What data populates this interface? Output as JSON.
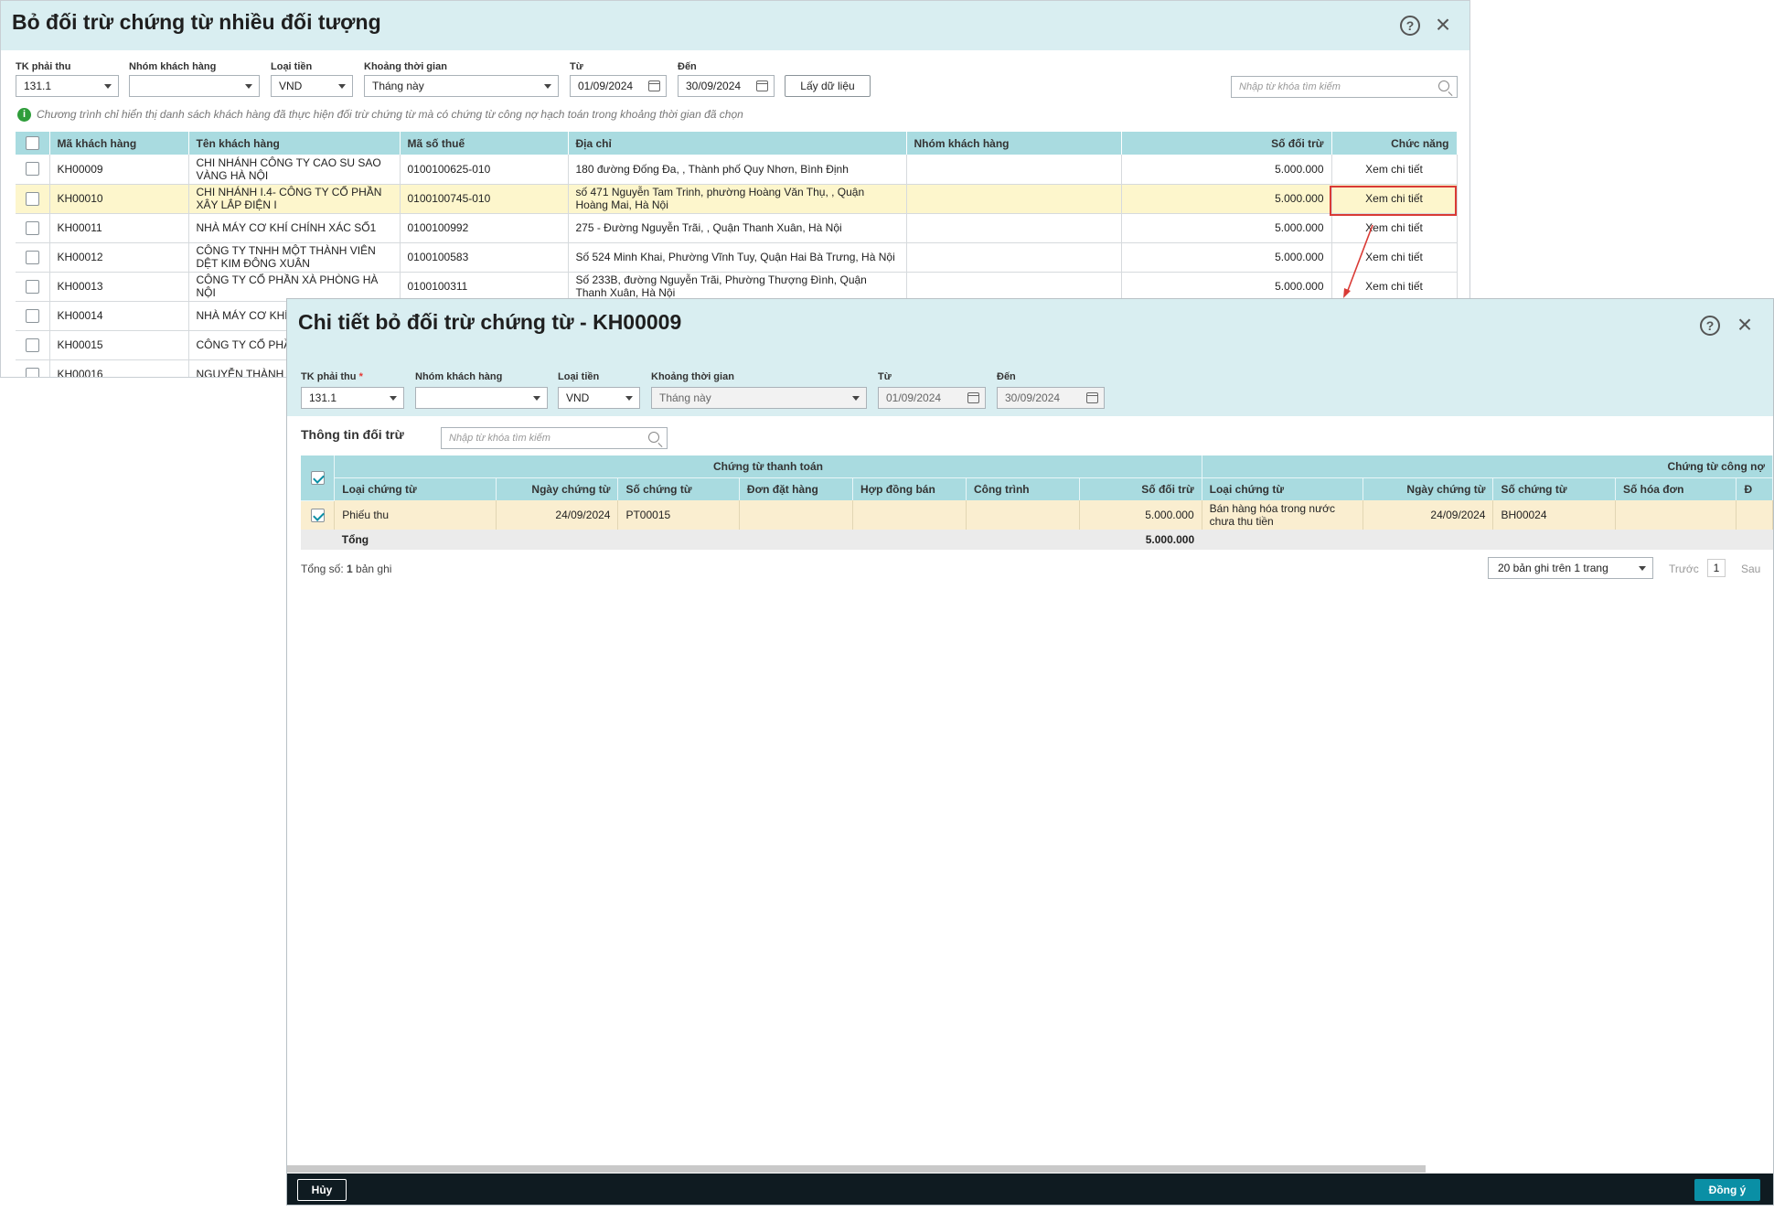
{
  "win1": {
    "title": "Bỏ đối trừ chứng từ nhiều đối tượng",
    "filters": {
      "account_label": "TK phải thu",
      "account_value": "131.1",
      "group_label": "Nhóm khách hàng",
      "group_value": "",
      "currency_label": "Loại tiền",
      "currency_value": "VND",
      "period_label": "Khoảng thời gian",
      "period_value": "Tháng này",
      "from_label": "Từ",
      "from_value": "01/09/2024",
      "to_label": "Đến",
      "to_value": "30/09/2024",
      "fetch_button": "Lấy dữ liệu",
      "search_placeholder": "Nhập từ khóa tìm kiếm"
    },
    "info": "Chương trình chỉ hiển thị danh sách khách hàng đã thực hiện đối trừ chứng từ mà có chứng từ công nợ hạch toán trong khoảng thời gian đã chọn",
    "columns": [
      "Mã khách hàng",
      "Tên khách hàng",
      "Mã số thuế",
      "Địa chỉ",
      "Nhóm khách hàng",
      "Số đối trừ",
      "Chức năng"
    ],
    "rows": [
      {
        "code": "KH00009",
        "name": "CHI NHÁNH CÔNG TY CAO SU SAO VÀNG HÀ NỘI",
        "tax": "0100100625-010",
        "address": "180 đường Đống Đa, , Thành phố Quy Nhơn, Bình Định",
        "group": "",
        "amount": "5.000.000",
        "action": "Xem chi tiết"
      },
      {
        "code": "KH00010",
        "name": "CHI NHÁNH I.4- CÔNG TY CỔ PHẦN XÂY LẮP ĐIỆN I",
        "tax": "0100100745-010",
        "address": "số 471 Nguyễn Tam Trinh, phường Hoàng Văn Thụ, , Quận Hoàng Mai, Hà Nội",
        "group": "",
        "amount": "5.000.000",
        "action": "Xem chi tiết"
      },
      {
        "code": "KH00011",
        "name": "NHÀ MÁY CƠ KHÍ CHÍNH XÁC SỐ1",
        "tax": "0100100992",
        "address": "275 - Đường Nguyễn Trãi, , Quận Thanh Xuân, Hà Nội",
        "group": "",
        "amount": "5.000.000",
        "action": "Xem chi tiết"
      },
      {
        "code": "KH00012",
        "name": "CÔNG TY TNHH MỘT THÀNH VIÊN DỆT KIM ĐÔNG XUÂN",
        "tax": "0100100583",
        "address": "Số 524 Minh Khai, Phường Vĩnh Tuy, Quận Hai Bà Trưng, Hà Nội",
        "group": "",
        "amount": "5.000.000",
        "action": "Xem chi tiết"
      },
      {
        "code": "KH00013",
        "name": "CÔNG TY CỔ PHẦN XÀ PHÒNG HÀ NỘI",
        "tax": "0100100311",
        "address": "Số 233B, đường Nguyễn Trãi, Phường Thượng Đình, Quận Thanh Xuân, Hà Nội",
        "group": "",
        "amount": "5.000.000",
        "action": "Xem chi tiết"
      },
      {
        "code": "KH00014",
        "name": "NHÀ MÁY CƠ KHÍ",
        "tax": "",
        "address": "",
        "group": "",
        "amount": "",
        "action": ""
      },
      {
        "code": "KH00015",
        "name": "CÔNG TY CỔ PHẦ",
        "tax": "",
        "address": "",
        "group": "",
        "amount": "",
        "action": ""
      },
      {
        "code": "KH00016",
        "name": "NGUYỄN THÀNH T",
        "tax": "",
        "address": "",
        "group": "",
        "amount": "",
        "action": ""
      }
    ]
  },
  "win2": {
    "title": "Chi tiết bỏ đối trừ chứng từ - KH00009",
    "filters": {
      "account_label": "TK phải thu",
      "account_required": "*",
      "account_value": "131.1",
      "group_label": "Nhóm khách hàng",
      "group_value": "",
      "currency_label": "Loại tiền",
      "currency_value": "VND",
      "period_label": "Khoảng thời gian",
      "period_value": "Tháng này",
      "from_label": "Từ",
      "from_value": "01/09/2024",
      "to_label": "Đến",
      "to_value": "30/09/2024"
    },
    "section_title": "Thông tin đối trừ",
    "search_placeholder": "Nhập từ khóa tìm kiếm",
    "group_payment": "Chứng từ thanh toán",
    "group_debt": "Chứng từ công nợ",
    "payment_columns": [
      "Loại chứng từ",
      "Ngày chứng từ",
      "Số chứng từ",
      "Đơn đặt hàng",
      "Hợp đồng bán",
      "Công trình",
      "Số đối trừ"
    ],
    "debt_columns": [
      "Loại chứng từ",
      "Ngày chứng từ",
      "Số chứng từ",
      "Số hóa đơn",
      "Đ"
    ],
    "row": {
      "pay_type": "Phiếu thu",
      "pay_date": "24/09/2024",
      "pay_no": "PT00015",
      "order": "",
      "contract": "",
      "project": "",
      "amount": "5.000.000",
      "debt_type": "Bán hàng hóa trong nước chưa thu tiền",
      "debt_date": "24/09/2024",
      "debt_no": "BH00024",
      "invoice_no": ""
    },
    "total_label": "Tổng",
    "total_amount": "5.000.000",
    "record_prefix": "Tổng số: ",
    "record_count": "1",
    "record_suffix": " bản ghi",
    "page_size": "20 bản ghi trên 1 trang",
    "prev": "Trước",
    "page": "1",
    "next": "Sau",
    "cancel": "Hủy",
    "ok": "Đồng ý"
  }
}
